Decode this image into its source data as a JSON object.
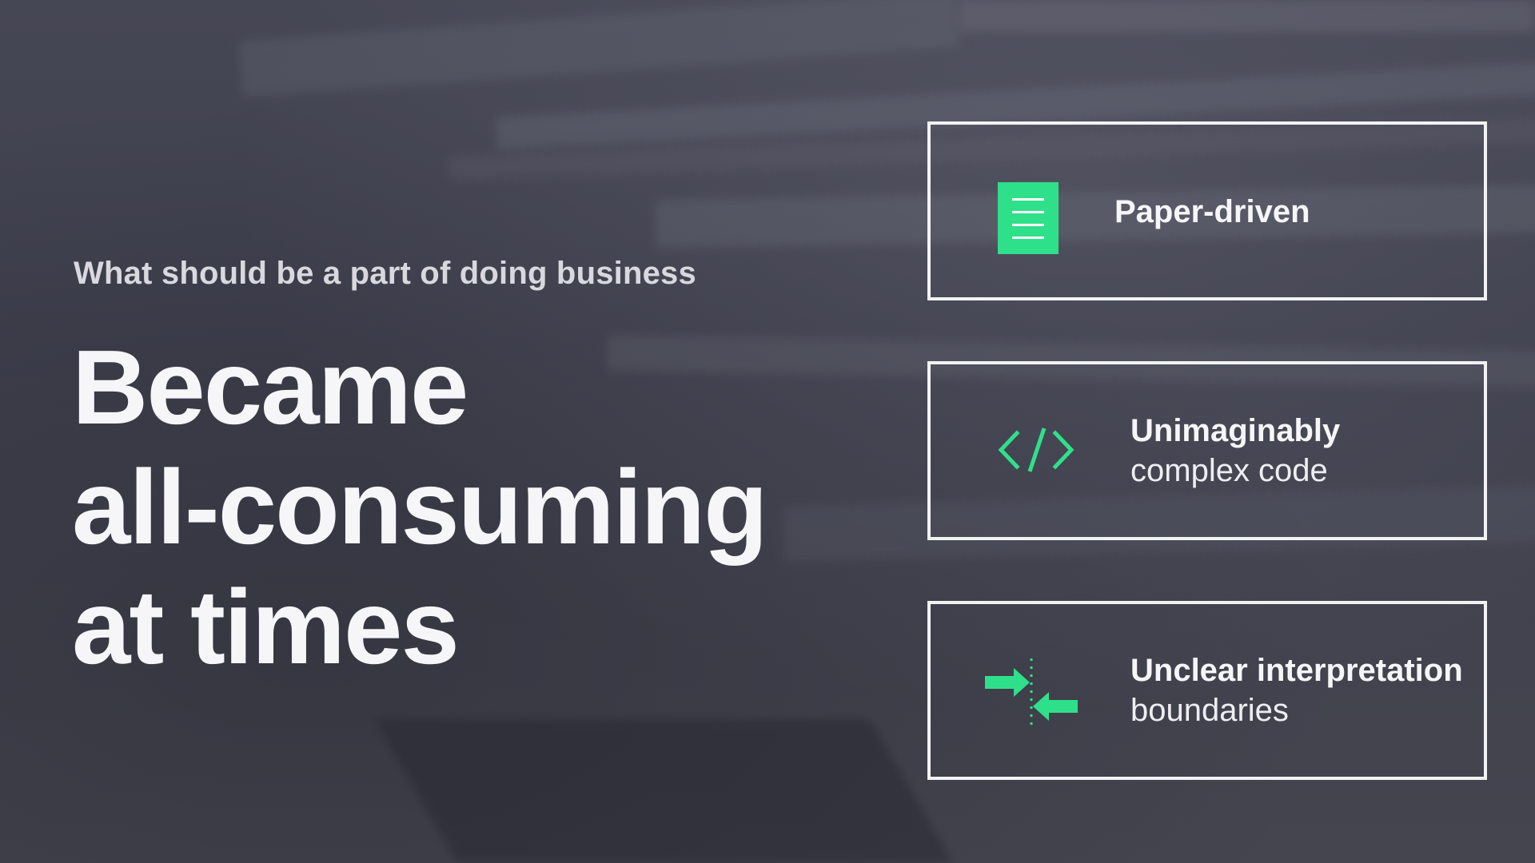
{
  "slide": {
    "subtitle": "What should be a part of doing business",
    "headline": {
      "line1": "Became",
      "line2": "all-consuming",
      "line3": "at times"
    }
  },
  "cards": [
    {
      "icon": "document-icon",
      "title": "Paper-driven",
      "detail": ""
    },
    {
      "icon": "code-brackets-icon",
      "title": "Unimaginably",
      "detail": "complex code"
    },
    {
      "icon": "converging-arrows-icon",
      "title": "Unclear interpretation",
      "detail": "boundaries"
    }
  ],
  "colors": {
    "accent": "#2fe08a",
    "background": "#3f404d",
    "text": "#f6f6f9",
    "subtitle": "#d8d8de"
  }
}
